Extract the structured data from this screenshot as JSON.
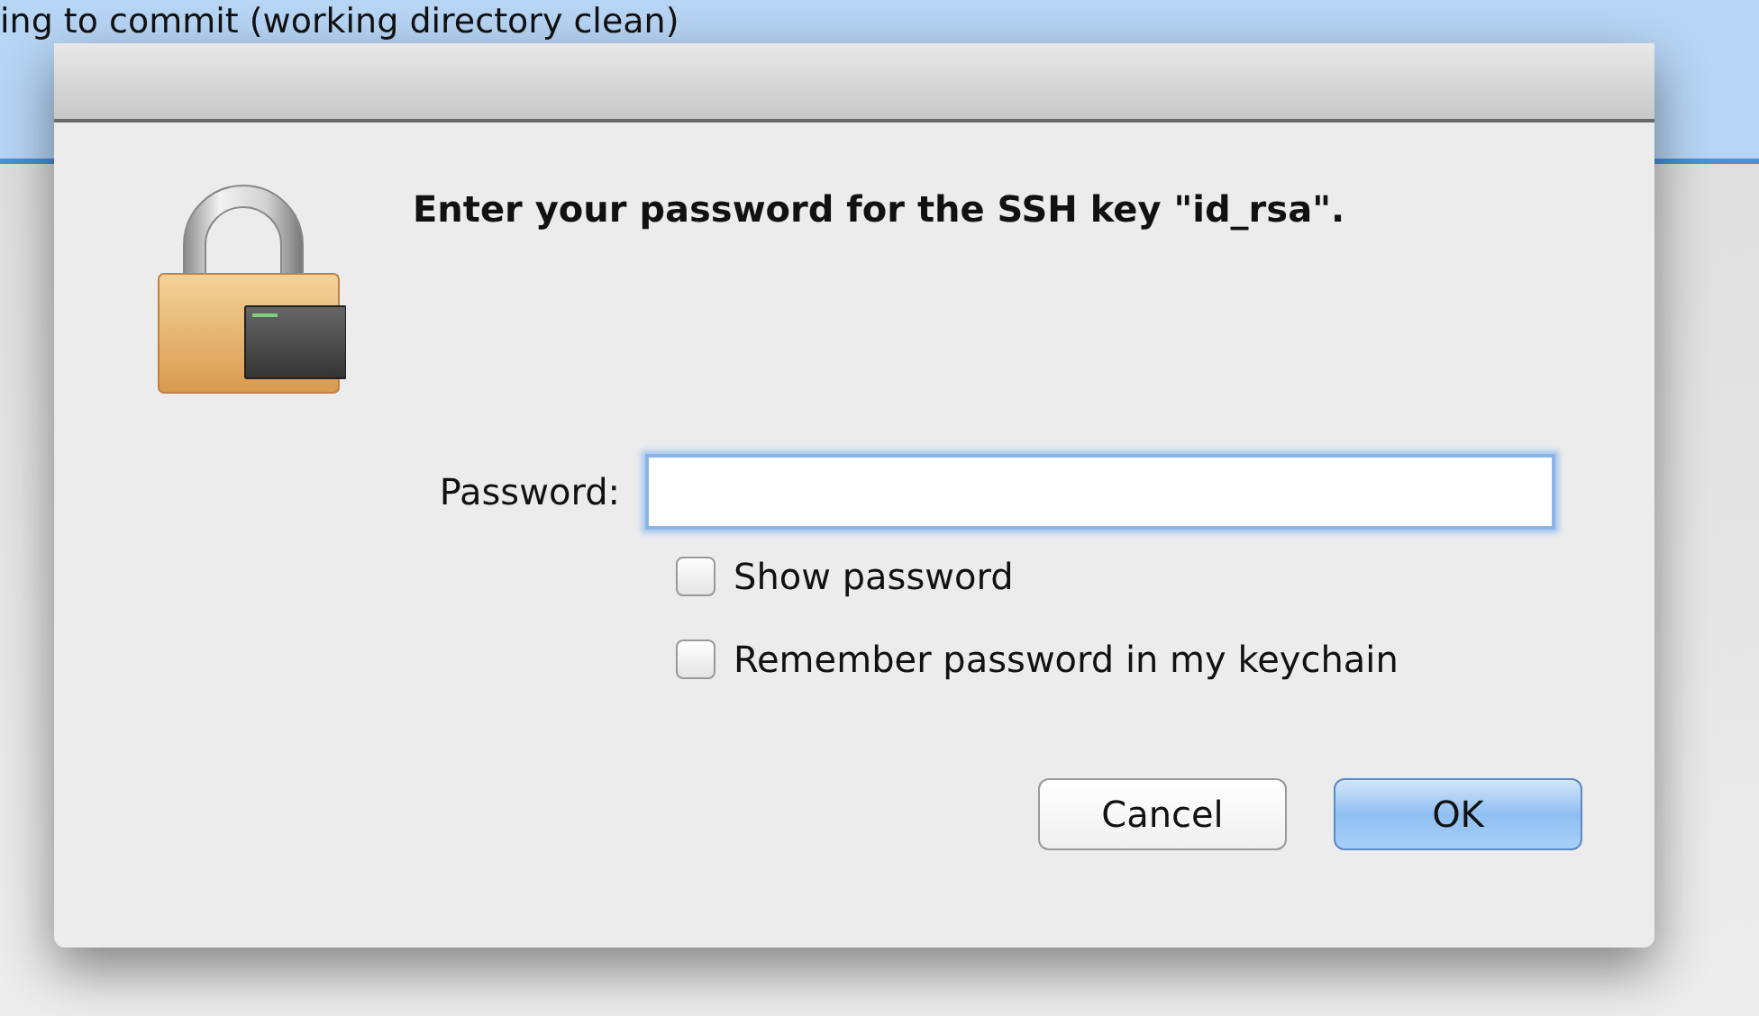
{
  "background": {
    "text": "ing to commit (working directory clean)"
  },
  "dialog": {
    "message": "Enter your password for the SSH key \"id_rsa\".",
    "password": {
      "label": "Password:",
      "focused": true
    },
    "checkboxes": [
      {
        "label": "Show password",
        "checked": false
      },
      {
        "label": "Remember password in my keychain",
        "checked": false
      }
    ],
    "buttons": [
      {
        "label": "Cancel",
        "default": false
      },
      {
        "label": "OK",
        "default": true
      }
    ]
  }
}
